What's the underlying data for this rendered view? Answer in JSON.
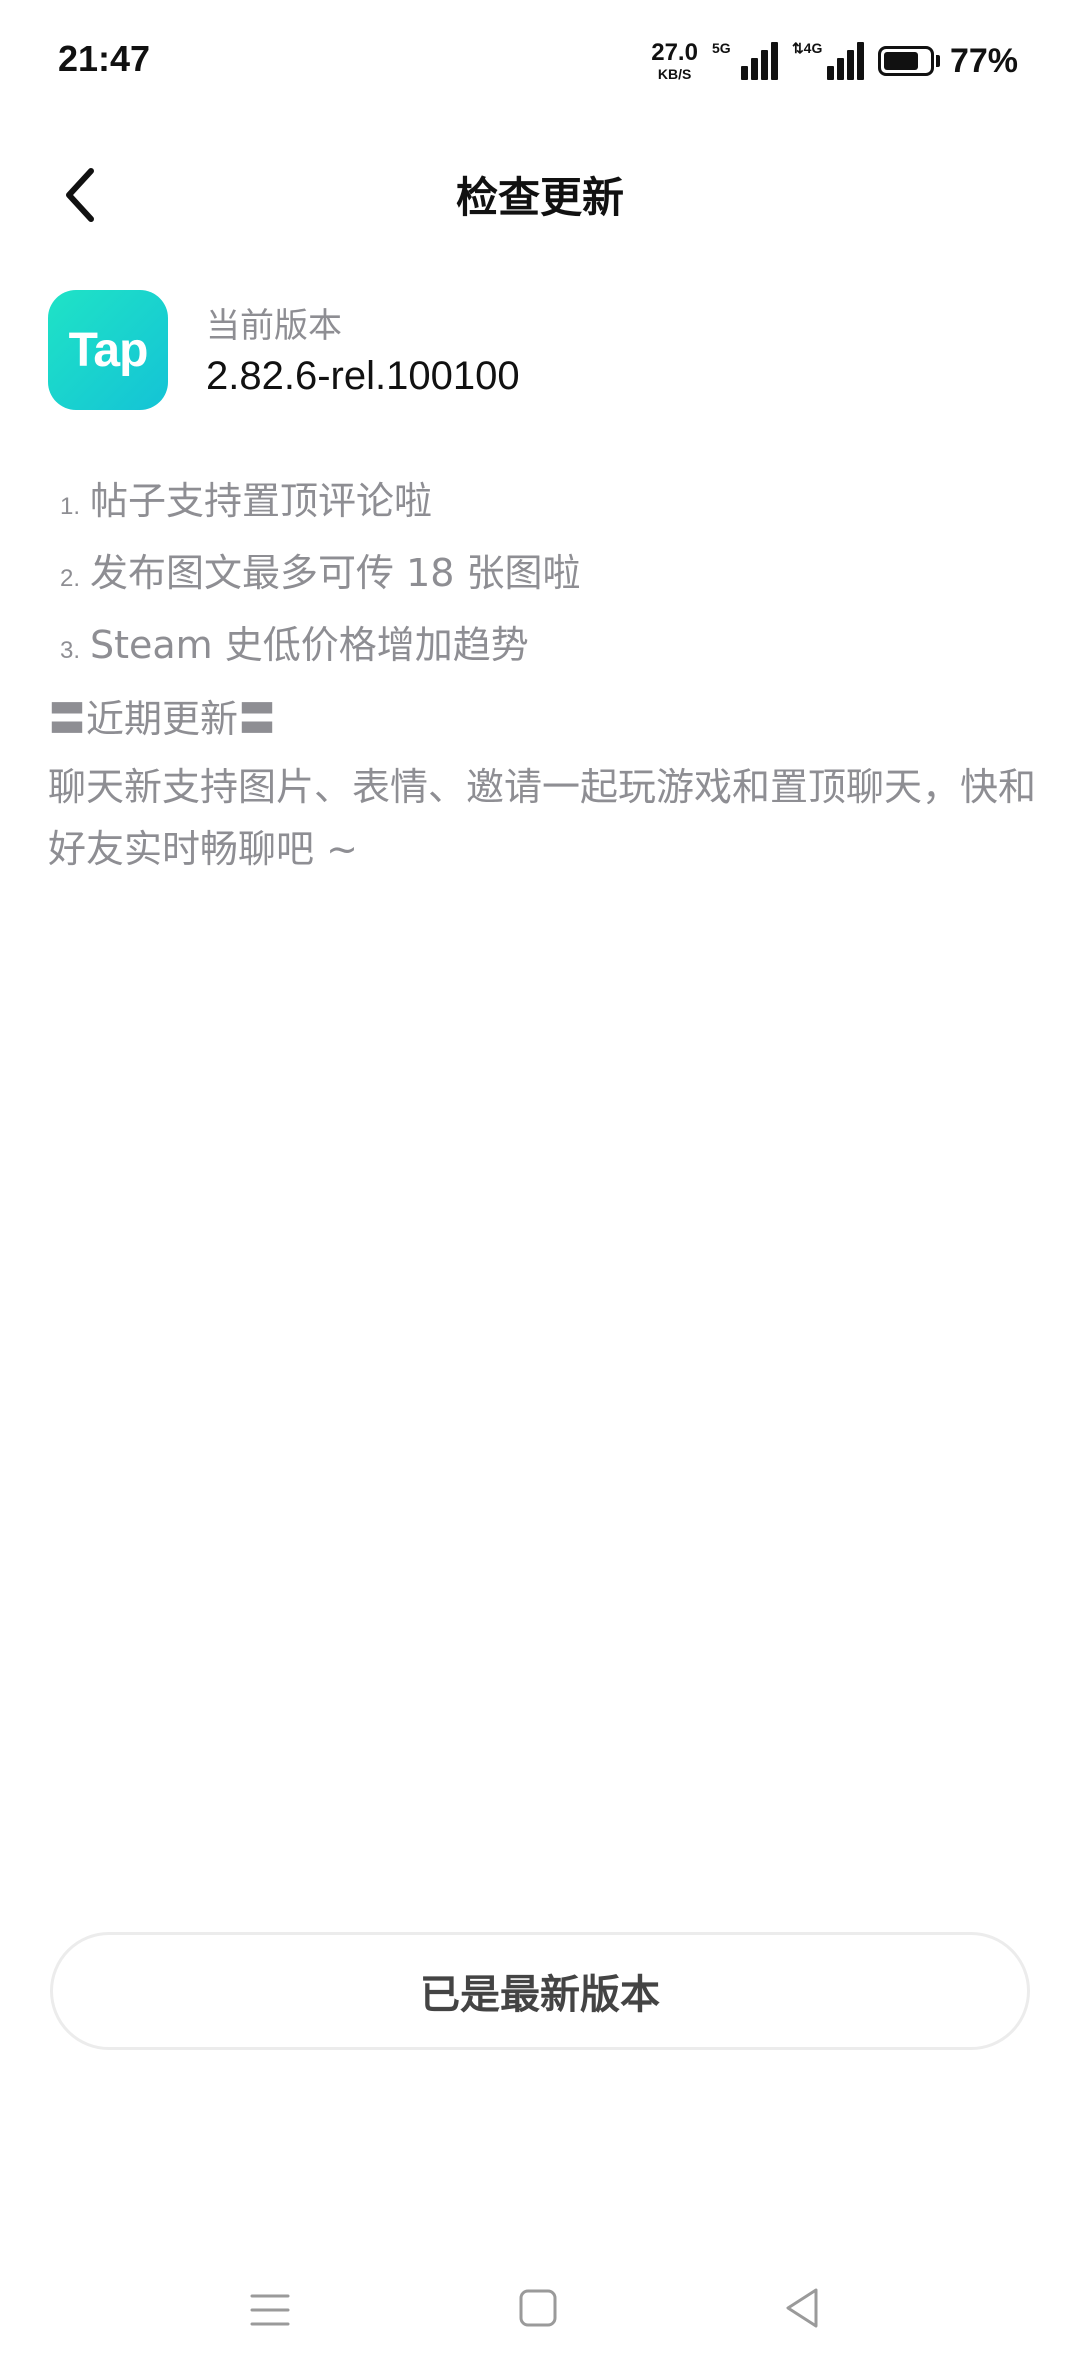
{
  "status_bar": {
    "time": "21:47",
    "net_speed_value": "27.0",
    "net_speed_unit": "KB/S",
    "sim1_tag": "5G",
    "sim2_tag": "⇅4G",
    "battery_percent": "77%",
    "battery_level": 0.77
  },
  "header": {
    "title": "检查更新",
    "back_icon": "chevron-left-icon"
  },
  "app": {
    "icon_text": "Tap",
    "icon_colors": [
      "#1fe3c6",
      "#14c3d6"
    ],
    "version_label": "当前版本",
    "version_value": "2.82.6-rel.100100"
  },
  "notes": {
    "items": [
      {
        "num": "1.",
        "text": "帖子支持置顶评论啦"
      },
      {
        "num": "2.",
        "text": "发布图文最多可传 18 张图啦"
      },
      {
        "num": "3.",
        "text": "Steam 史低价格增加趋势"
      }
    ],
    "recent_heading": "〓近期更新〓",
    "recent_desc": "聊天新支持图片、表情、邀请一起玩游戏和置顶聊天，快和好友实时畅聊吧 ~"
  },
  "status_button": {
    "label": "已是最新版本"
  },
  "nav_bar": {
    "menu_icon": "menu-icon",
    "home_icon": "home-icon",
    "back_icon": "back-triangle-icon"
  }
}
